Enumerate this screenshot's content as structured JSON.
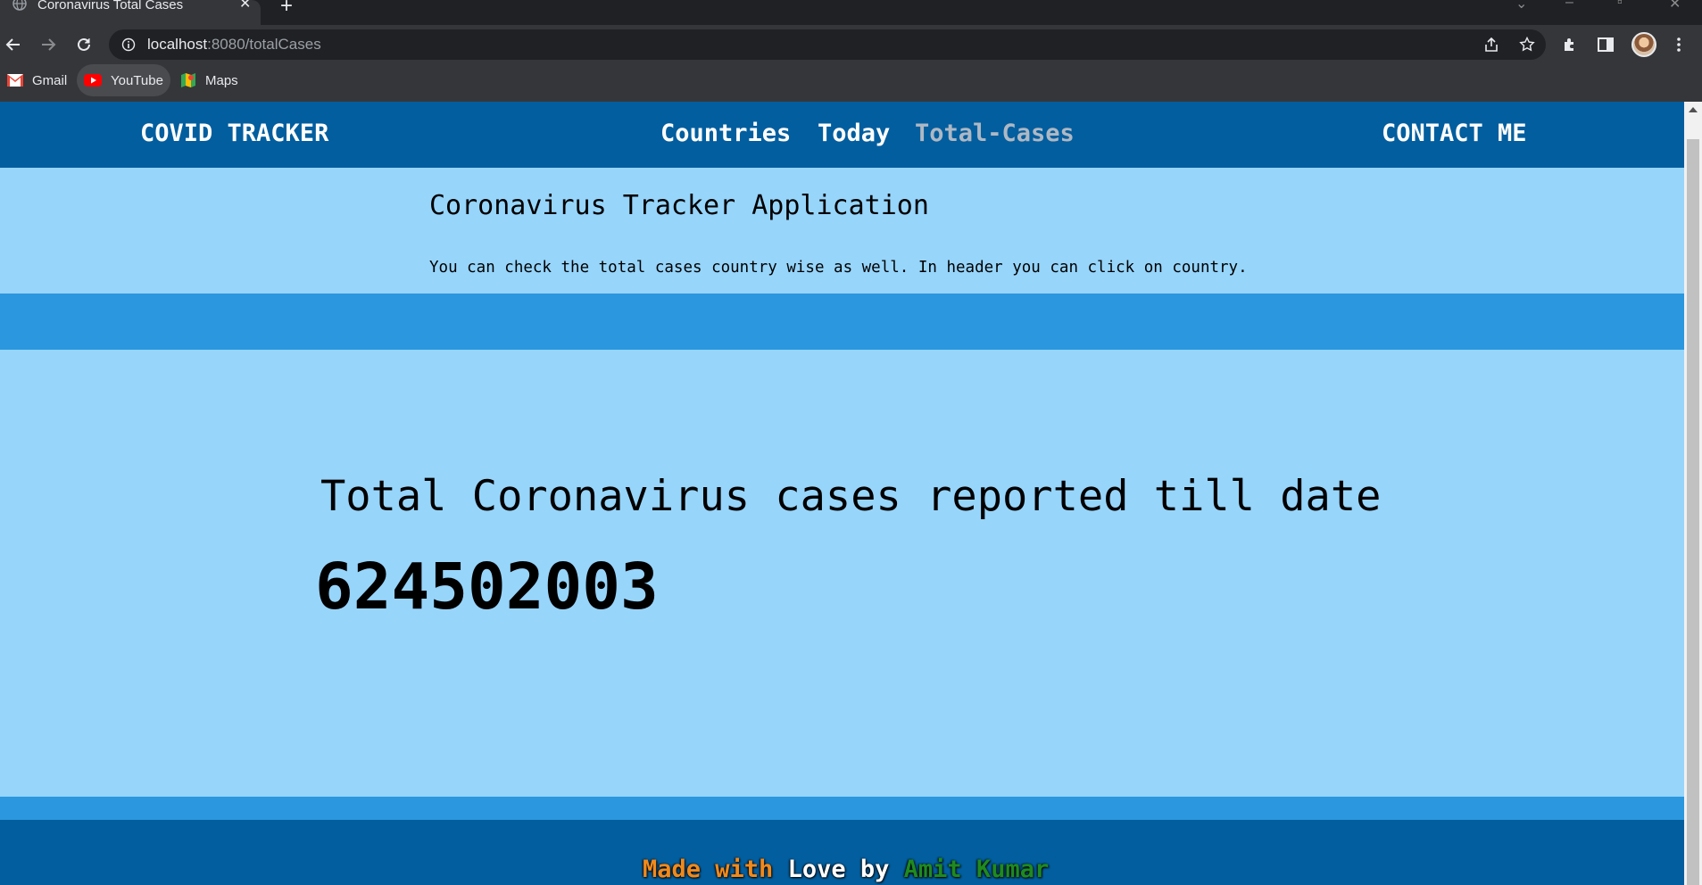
{
  "browser": {
    "tab_title": "Coronavirus Total Cases",
    "tab_close": "✕",
    "new_tab": "+",
    "url_host": "localhost",
    "url_rest": ":8080/totalCases",
    "bookmarks": [
      {
        "label": "Gmail",
        "icon": "gmail-icon"
      },
      {
        "label": "YouTube",
        "icon": "youtube-icon"
      },
      {
        "label": "Maps",
        "icon": "maps-icon"
      }
    ]
  },
  "navbar": {
    "brand": "COVID TRACKER",
    "links": [
      "Countries",
      "Today",
      "Total-Cases"
    ],
    "active": "Total-Cases",
    "contact": "CONTACT ME"
  },
  "hero": {
    "title": "Coronavirus Tracker Application",
    "subtitle": "You can check the total cases country wise as well. In header you can click on country."
  },
  "main": {
    "label": "Total Coronavirus cases reported till date",
    "total": "624502003"
  },
  "footer": {
    "parts": [
      {
        "text": "Made with",
        "color": "#f08a1c"
      },
      {
        "text": "Love",
        "color": "#ffffff"
      },
      {
        "text": "by",
        "color": "#ffffff"
      },
      {
        "text": "Amit Kumar",
        "color": "#1f8a1f"
      }
    ]
  },
  "colors": {
    "navbar": "#025e9e",
    "band": "#2b97df",
    "background": "#97d5fb"
  }
}
